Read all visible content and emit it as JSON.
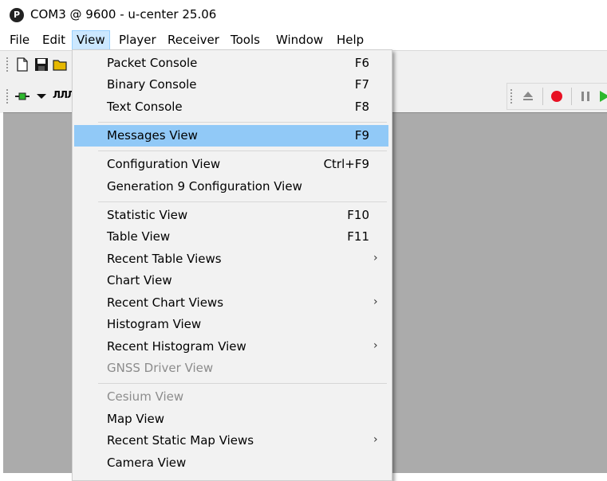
{
  "window": {
    "title": "COM3 @ 9600 - u-center 25.06",
    "app_icon_letter": "P"
  },
  "menubar": {
    "items": [
      {
        "label": "File"
      },
      {
        "label": "Edit"
      },
      {
        "label": "View"
      },
      {
        "label": "Player"
      },
      {
        "label": "Receiver"
      },
      {
        "label": "Tools"
      },
      {
        "label": "Window"
      },
      {
        "label": "Help"
      }
    ],
    "active": "View"
  },
  "toolbar": {
    "waveform_glyph": "ЛЛЛ"
  },
  "view_menu": {
    "items": [
      {
        "label": "Packet Console",
        "shortcut": "F6"
      },
      {
        "label": "Binary Console",
        "shortcut": "F7"
      },
      {
        "label": "Text Console",
        "shortcut": "F8"
      },
      {
        "label": "Messages View",
        "shortcut": "F9",
        "highlighted": true
      },
      {
        "label": "Configuration View",
        "shortcut": "Ctrl+F9"
      },
      {
        "label": "Generation 9 Configuration View",
        "shortcut": ""
      },
      {
        "label": "Statistic View",
        "shortcut": "F10"
      },
      {
        "label": "Table View",
        "shortcut": "F11"
      },
      {
        "label": "Recent Table Views",
        "submenu": true
      },
      {
        "label": "Chart View"
      },
      {
        "label": "Recent Chart Views",
        "submenu": true
      },
      {
        "label": "Histogram View"
      },
      {
        "label": "Recent Histogram View",
        "submenu": true
      },
      {
        "label": "GNSS Driver View",
        "disabled": true
      },
      {
        "label": "Cesium View",
        "disabled": true
      },
      {
        "label": "Map View"
      },
      {
        "label": "Recent Static Map Views",
        "submenu": true
      },
      {
        "label": "Camera View"
      }
    ],
    "submenu_arrow": "›"
  },
  "colors": {
    "highlight": "#91c9f7",
    "menu_bg": "#f2f2f2",
    "client_bg": "#ababab",
    "record_red": "#e81123",
    "play_green": "#2eb82e"
  }
}
